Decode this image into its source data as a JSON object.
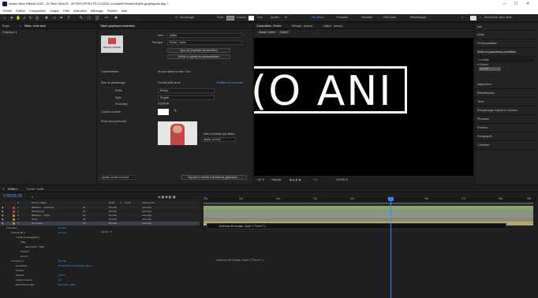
{
  "window": {
    "title": "Adobe After Effects 2022 - D:\\Tech VAACE - AFTER EFFECTS CC2020 Complété\\Textes\\Objets graphiques.aep *",
    "minimize": "—",
    "maximize": "☐",
    "close": "✕"
  },
  "menu": [
    "Fichier",
    "Edition",
    "Composition",
    "Calque",
    "Effet",
    "Animation",
    "Affichage",
    "Fenêtre",
    "Aide"
  ],
  "toolbar": {
    "align_label": "Accrochage",
    "fill_label": "Fond :",
    "stroke_label": "Contour :",
    "stroke_px": "3 px",
    "add_label": "Ajouter :",
    "workspaces": [
      "Par défaut",
      "Formation",
      "Standard",
      "Petit écran",
      "Bibliothèques"
    ],
    "workspace_more": "»",
    "search_placeholder": "Rechercher dans l'aide"
  },
  "project_panel": {
    "tabs": [
      "Projet",
      "Effets : texte texte"
    ],
    "selected": "Graphique ≡"
  },
  "essential_graphics": {
    "tab": "Objets graphiques essentiels",
    "name_label": "Nom :",
    "name_value": "Avatar",
    "primary_label": "Principal :",
    "primary_value": "Entrez + sortie",
    "thumb_caption": "MON ET TECHNI",
    "add_props_btn": "Ajout de propriétés sélectionnées",
    "set_poster_btn": "Définir la vignette de prévisualisation",
    "comments_label": "Commentaires",
    "comments_value": "Ne pas utiliser la date : Fixe",
    "person_label": "Nom du personnage",
    "font_value": "Fournie taille ancre",
    "set_props_label": "Modifier les propriétés",
    "police_label": "Police",
    "police_value": "Roboto",
    "style_label": "Style",
    "style_value": "Regular",
    "font_style_label": "Fond style",
    "font_style_value": "T  T  TT  T²",
    "color_label": "Couleur du texte",
    "photo_label": "Photo de la personne",
    "media_note": "Mise à l'échelle par défaut :",
    "media_fit": "Ajuster au fond",
    "add_layout_label": "Ajouter la mise en forme",
    "export_btn": "Exporter le modèle d'animations graphiques..."
  },
  "composition": {
    "tabs": [
      "Composition : Entrée",
      "Métrage : (aucun)",
      "Calque : (aucun)"
    ],
    "breadcrumbs": [
      "Avatar + sortie",
      "Entrée"
    ],
    "canvas_text": "(O ANI",
    "zoom": "100 %",
    "resolution": "Intégrale",
    "exposure": "+0,0",
    "timecode": "0;00;05;15"
  },
  "right_panel": {
    "items": [
      "Info",
      "Audio",
      "Prévisualisation",
      "Effets et paramètres prédéfinis",
      "Alignement",
      "Bibliothèques",
      "Texte",
      "Remplissage d'après le contenu",
      "Pinceaux",
      "Peinture",
      "Paragraphe",
      "Caractère"
    ],
    "search_value": "ƒx  remplir",
    "section": "▾ Générer",
    "sub_item": "Remplir"
  },
  "timeline": {
    "tabs": [
      "Entrée ≡",
      "Forme + sortie"
    ],
    "current_time": "0;00;03;28",
    "column_headers": [
      "#",
      "Nom du calque",
      "Mode",
      "T",
      "Cache",
      "Parent et lien"
    ],
    "layers": [
      {
        "num": "1",
        "name": "[Masque ... précomp]",
        "mode": "Normal",
        "parent": "Aucun(e)",
        "color": "#c43c3c"
      },
      {
        "num": "2",
        "name": "[Pistes].png",
        "mode": "Normal",
        "parent": "Aucun(e)",
        "color": "#c43c3c"
      },
      {
        "num": "3",
        "name": "[Masque ... Tech]",
        "mode": "Normal",
        "parent": "Aucun(e)",
        "color": "#b58a2a"
      },
      {
        "num": "4",
        "name": "Texte",
        "mode": "Normal",
        "parent": "Aucun(e)",
        "color": "#b58a2a"
      },
      {
        "num": "5",
        "name": "Nom texte",
        "mode": "Normal",
        "parent": "Aucun(e)",
        "color": "#b58a2a"
      }
    ],
    "sub_rows": [
      "▾ Contenu",
      "▾ Rectangle 1",
      "▾ Tracé rectangulaire 1",
      "Taille",
      "Expression : Taille",
      "Position",
      "Arrondi",
      "▾ Contour 1",
      "Composite",
      "Couleur",
      "Opacité",
      "Largeur contour",
      "Extrémité de ligne"
    ],
    "sub_values": [
      "Normal",
      "Normal",
      "",
      "",
      "",
      "",
      "",
      "Normal",
      "En dessous du précédent dans ~",
      "",
      "100 %",
      "4,0",
      "Extrémité vérifié"
    ],
    "add_label": "Ajouter : ●",
    "ruler": [
      "00s",
      "01s",
      "02s",
      "03s",
      "04s",
      "05s",
      "06s",
      "07s",
      "08s",
      "09s"
    ],
    "expression_1": "contenu+thisComp.layer(\"Texte\");",
    "expression_2": "contenu+thisComp.layer(\"Texte\");"
  },
  "colors": {
    "accent": "#4aa3ff",
    "playhead": "#2d8cff",
    "canvas_bg": "#000000",
    "canvas_text": "#ffffff"
  }
}
